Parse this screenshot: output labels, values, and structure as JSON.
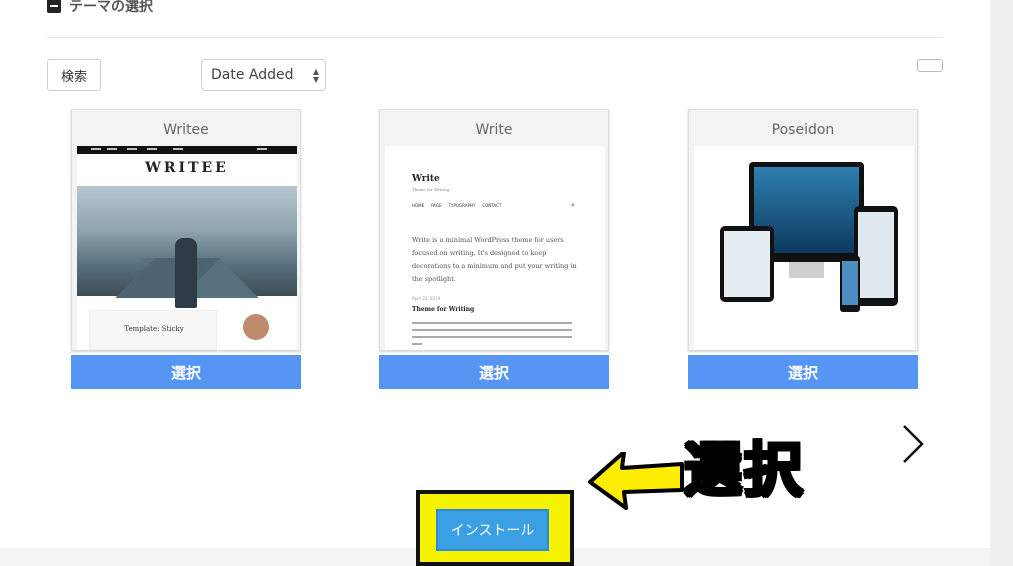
{
  "section": {
    "title": "テーマの選択"
  },
  "toolbar": {
    "search_label": "検索",
    "sort": {
      "selected": "Date Added"
    }
  },
  "themes": [
    {
      "name": "Writee",
      "select_label": "選択",
      "preview": {
        "logo": "WRITEE",
        "featured_post": "Template: Sticky"
      }
    },
    {
      "name": "Write",
      "select_label": "選択",
      "preview": {
        "site_title": "Write",
        "tagline": "Theme for Writing",
        "menu": [
          "HOME",
          "PAGE",
          "TYPOGRAPHY",
          "CONTACT"
        ],
        "intro": "Write is a minimal WordPress theme for users focused on writing. It's designed to keep decorations to a minimum and put your writing in the spotlight.",
        "post_date": "April 22, 2019",
        "post_title": "Theme for Writing"
      }
    },
    {
      "name": "Poseidon",
      "select_label": "選択",
      "preview": {}
    }
  ],
  "install": {
    "label": "インストール"
  },
  "annotation": {
    "callout_text": "選択",
    "color": "#ffed00"
  },
  "colors": {
    "select_button": "#5695f4",
    "install_button": "#3b9fe3",
    "highlight": "#f6f300"
  }
}
